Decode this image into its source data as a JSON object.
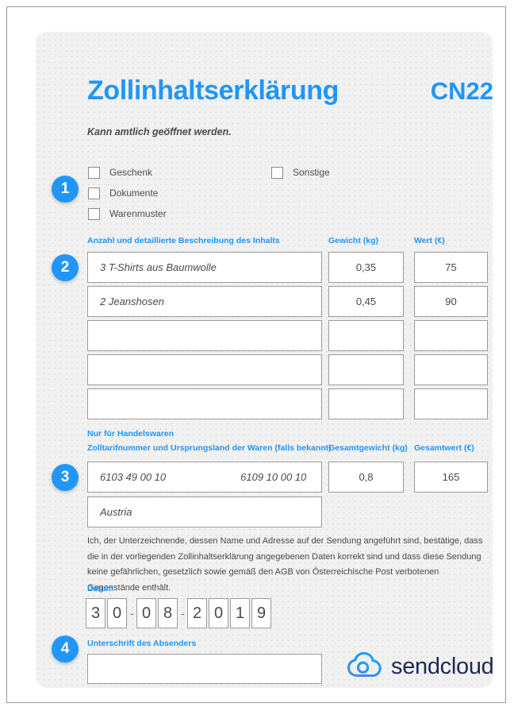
{
  "document": {
    "title": "Zollinhaltserklärung",
    "code": "CN22",
    "subtitle": "Kann amtlich geöffnet werden."
  },
  "steps": [
    {
      "number": "1"
    },
    {
      "number": "2"
    },
    {
      "number": "3"
    },
    {
      "number": "4"
    }
  ],
  "content_type": {
    "options_left": [
      {
        "label": "Geschenk",
        "checked": false
      },
      {
        "label": "Dokumente",
        "checked": false
      },
      {
        "label": "Warenmuster",
        "checked": false
      }
    ],
    "options_right": [
      {
        "label": "Sonstige",
        "checked": false
      }
    ]
  },
  "items_table": {
    "headers": {
      "description": "Anzahl und detaillierte Beschreibung des Inhalts",
      "weight": "Gewicht (kg)",
      "value": "Wert (€)"
    },
    "rows": [
      {
        "description": "3 T-Shirts aus Baumwolle",
        "weight": "0,35",
        "value": "75"
      },
      {
        "description": "2 Jeanshosen",
        "weight": "0,45",
        "value": "90"
      },
      {
        "description": "",
        "weight": "",
        "value": ""
      },
      {
        "description": "",
        "weight": "",
        "value": ""
      },
      {
        "description": "",
        "weight": "",
        "value": ""
      }
    ]
  },
  "commercial": {
    "section_label": "Nur für Handelswaren",
    "headers": {
      "tariff": "Zolltarifnummer und Ursprungsland der Waren (falls bekannt)",
      "total_weight": "Gesamtgewicht (kg)",
      "total_value": "Gesamtwert (€)"
    },
    "tariff_number_1": "6103 49 00 10",
    "tariff_number_2": "6109 10 00 10",
    "country_of_origin": "Austria",
    "total_weight": "0,8",
    "total_value": "165"
  },
  "declaration": {
    "text": "Ich, der Unterzeichnende, dessen Name und Adresse auf der Sendung angeführt sind, bestätige, dass die in der vorliegenden Zollinhaltserklärung angegebenen Daten korrekt sind und dass diese Sendung keine gefährlichen, gesetzlich sowie gemäß den AGB von Österreichische Post verbotenen Gegenstände enthält."
  },
  "date": {
    "label": "Datum",
    "digits": [
      "3",
      "0",
      "0",
      "8",
      "2",
      "0",
      "1",
      "9"
    ],
    "separator": "-",
    "value": "30-08-2019"
  },
  "signature": {
    "label": "Unterschrift des Absenders",
    "value": ""
  },
  "branding": {
    "name": "sendcloud",
    "icon": "cloud-icon",
    "accent_color": "#2196f7",
    "wordmark_color": "#1d2a50"
  }
}
